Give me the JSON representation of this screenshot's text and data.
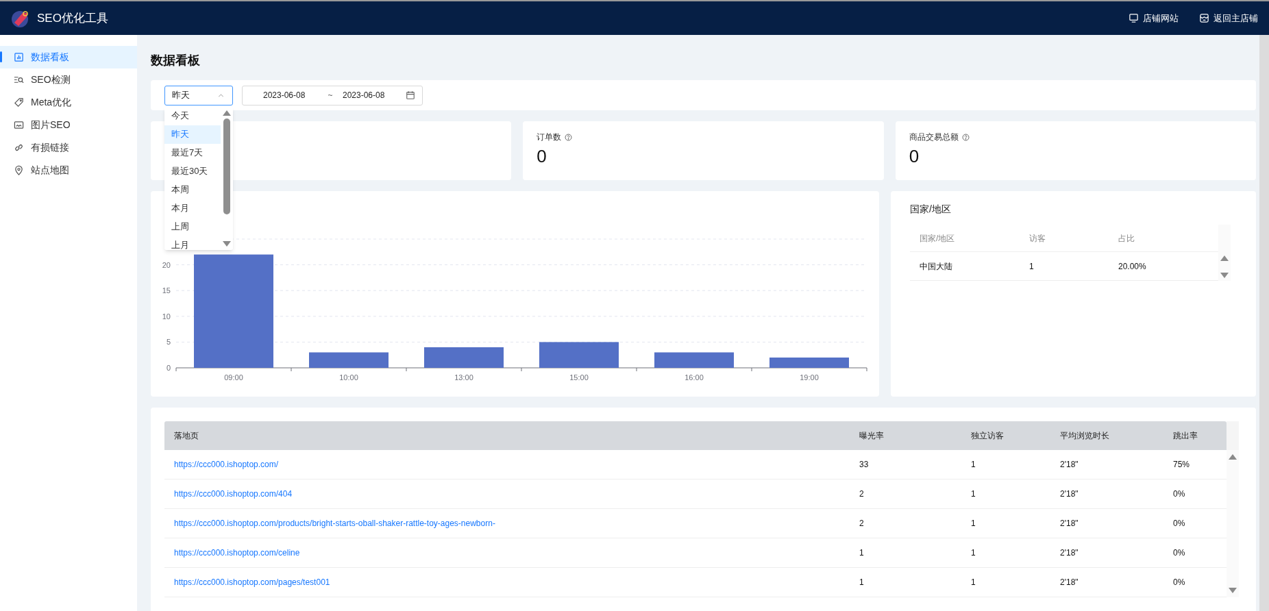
{
  "header": {
    "title": "SEO优化工具",
    "links": [
      {
        "label": "店铺网站"
      },
      {
        "label": "返回主店铺"
      }
    ]
  },
  "sidebar": {
    "items": [
      {
        "label": "数据看板",
        "selected": true
      },
      {
        "label": "SEO检测",
        "selected": false
      },
      {
        "label": "Meta优化",
        "selected": false
      },
      {
        "label": "图片SEO",
        "selected": false
      },
      {
        "label": "有损链接",
        "selected": false
      },
      {
        "label": "站点地图",
        "selected": false
      }
    ]
  },
  "page_title": "数据看板",
  "filter": {
    "period": {
      "value": "昨天",
      "expanded": true,
      "options": [
        {
          "label": "今天",
          "selected": false
        },
        {
          "label": "昨天",
          "selected": true
        },
        {
          "label": "最近7天",
          "selected": false
        },
        {
          "label": "最近30天",
          "selected": false
        },
        {
          "label": "本周",
          "selected": false
        },
        {
          "label": "本月",
          "selected": false
        },
        {
          "label": "上周",
          "selected": false
        },
        {
          "label": "上月",
          "selected": false
        }
      ]
    },
    "date_range": {
      "start": "2023-06-08",
      "separator": "~",
      "end": "2023-06-08"
    }
  },
  "stats": [
    {
      "label": "订单数",
      "value": "0"
    },
    {
      "label": "商品交易总额",
      "value": "0"
    }
  ],
  "visits_chart": {
    "chart_data": {
      "type": "bar",
      "categories": [
        "09:00",
        "10:00",
        "13:00",
        "15:00",
        "16:00",
        "19:00"
      ],
      "series": [
        {
          "color": "#5470c6",
          "values": [
            22,
            3,
            4,
            5,
            3,
            2
          ]
        }
      ],
      "ylim": [
        0,
        25
      ],
      "yticks": [
        0,
        5,
        10,
        15,
        20
      ],
      "grid": true
    }
  },
  "country_table": {
    "title": "国家/地区",
    "columns": [
      "国家/地区",
      "访客",
      "占比"
    ],
    "rows": [
      [
        "中国大陆",
        "1",
        "20.00%"
      ]
    ]
  },
  "landing_table": {
    "columns": [
      "落地页",
      "曝光率",
      "独立访客",
      "平均浏览时长",
      "跳出率"
    ],
    "rows": [
      [
        "https://ccc000.ishoptop.com/",
        "33",
        "1",
        "2'18\"",
        "75%"
      ],
      [
        "https://ccc000.ishoptop.com/404",
        "2",
        "1",
        "2'18\"",
        "0%"
      ],
      [
        "https://ccc000.ishoptop.com/products/bright-starts-oball-shaker-rattle-toy-ages-newborn-",
        "2",
        "1",
        "2'18\"",
        "0%"
      ],
      [
        "https://ccc000.ishoptop.com/celine",
        "1",
        "1",
        "2'18\"",
        "0%"
      ],
      [
        "https://ccc000.ishoptop.com/pages/test001",
        "1",
        "1",
        "2'18\"",
        "0%"
      ]
    ]
  }
}
